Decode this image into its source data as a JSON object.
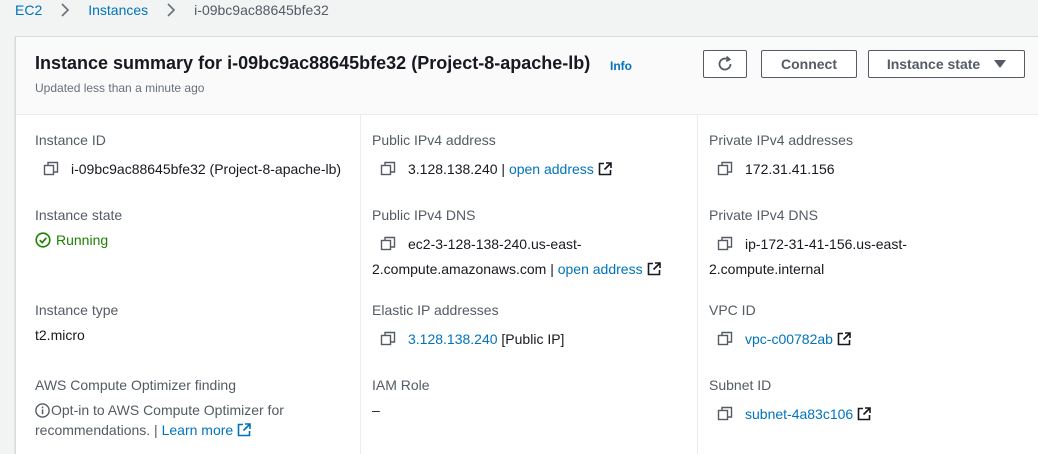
{
  "breadcrumb": {
    "root": "EC2",
    "instances": "Instances",
    "current": "i-09bc9ac88645bfe32"
  },
  "header": {
    "title": "Instance summary for i-09bc9ac88645bfe32 (Project-8-apache-lb)",
    "info": "Info",
    "updated": "Updated less than a minute ago",
    "connect_label": "Connect",
    "instance_state_label": "Instance state"
  },
  "fields": {
    "instance_id": {
      "label": "Instance ID",
      "value": "i-09bc9ac88645bfe32 (Project-8-apache-lb)"
    },
    "instance_state": {
      "label": "Instance state",
      "value": "Running"
    },
    "instance_type": {
      "label": "Instance type",
      "value": "t2.micro"
    },
    "compute_optimizer": {
      "label": "AWS Compute Optimizer finding",
      "line1": "Opt-in to AWS Compute Optimizer for",
      "line2": "recommendations. |",
      "link": "Learn more"
    },
    "public_ipv4": {
      "label": "Public IPv4 address",
      "value": "3.128.138.240 |",
      "link": "open address"
    },
    "public_dns": {
      "label": "Public IPv4 DNS",
      "line1": "ec2-3-128-138-240.us-east-",
      "line2": "2.compute.amazonaws.com |",
      "link": "open address"
    },
    "elastic_ip": {
      "label": "Elastic IP addresses",
      "link": "3.128.138.240",
      "suffix": "[Public IP]"
    },
    "iam_role": {
      "label": "IAM Role",
      "value": "–"
    },
    "private_ipv4": {
      "label": "Private IPv4 addresses",
      "value": "172.31.41.156"
    },
    "private_dns": {
      "label": "Private IPv4 DNS",
      "line1": "ip-172-31-41-156.us-east-",
      "line2": "2.compute.internal"
    },
    "vpc_id": {
      "label": "VPC ID",
      "link": "vpc-c00782ab"
    },
    "subnet_id": {
      "label": "Subnet ID",
      "link": "subnet-4a83c106"
    }
  },
  "icons": [
    "copy-icon",
    "external-link-icon",
    "refresh-icon",
    "caret-down-icon",
    "check-circle-icon",
    "info-circle-icon",
    "chevron-right-icon"
  ],
  "colors": {
    "link": "#0073bb",
    "running": "#1d8102",
    "label": "#545b64",
    "text": "#16191f"
  }
}
